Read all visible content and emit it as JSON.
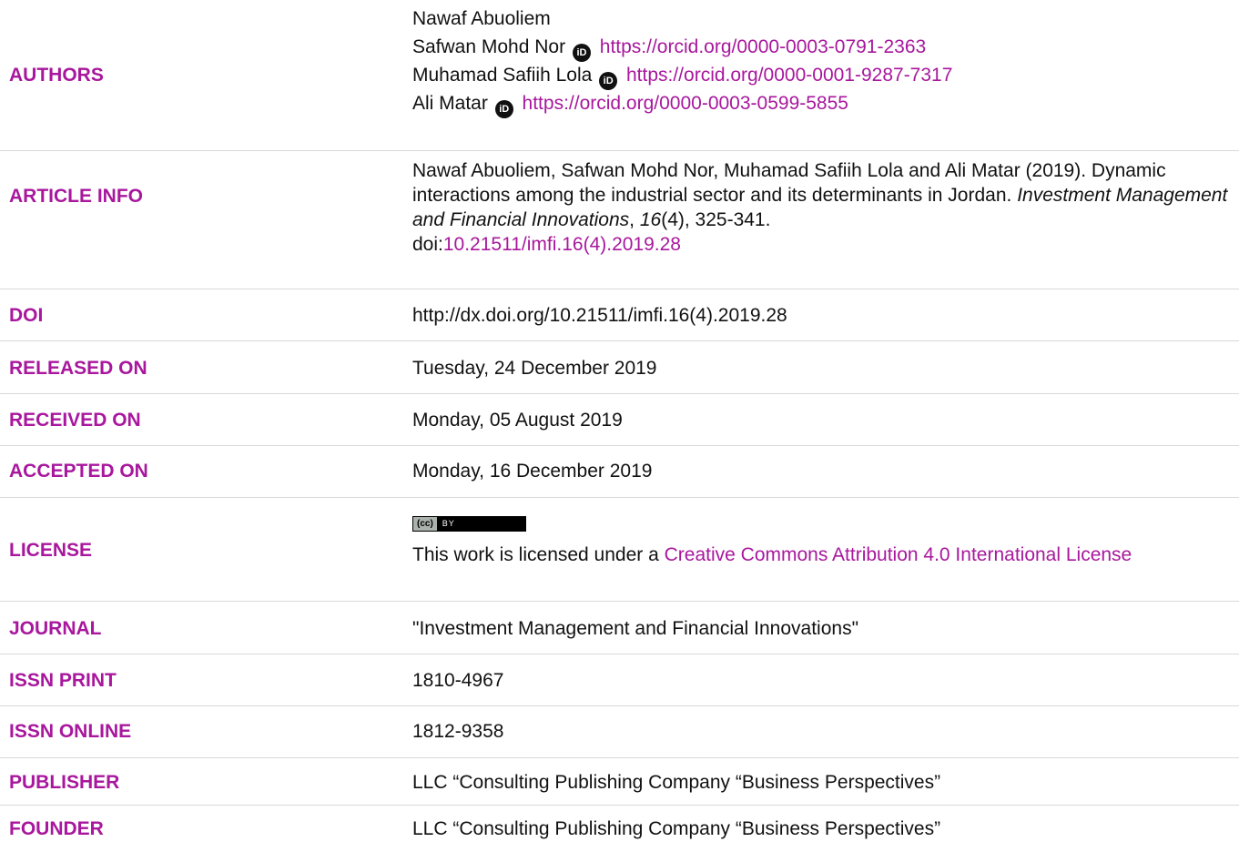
{
  "authors": {
    "label": "AUTHORS",
    "list": [
      {
        "name": "Nawaf Abuoliem",
        "orcid": ""
      },
      {
        "name": "Safwan Mohd Nor",
        "orcid": "https://orcid.org/0000-0003-0791-2363"
      },
      {
        "name": "Muhamad Safiih Lola",
        "orcid": "https://orcid.org/0000-0001-9287-7317"
      },
      {
        "name": "Ali Matar",
        "orcid": "https://orcid.org/0000-0003-0599-5855"
      }
    ]
  },
  "article_info": {
    "label": "ARTICLE INFO",
    "citation_start": "Nawaf Abuoliem, Safwan Mohd Nor, Muhamad Safiih Lola and Ali Matar (2019). Dynamic interactions among the industrial sector and its determinants in Jordan. ",
    "journal_italic": "Investment Management and Financial Innovations",
    "comma": ", ",
    "volume_italic": "16",
    "issue_pages": "(4), 325-341.",
    "doi_prefix": "doi:",
    "doi_link": "10.21511/imfi.16(4).2019.28"
  },
  "doi": {
    "label": "DOI",
    "value": "http://dx.doi.org/10.21511/imfi.16(4).2019.28"
  },
  "released": {
    "label": "RELEASED ON",
    "value": "Tuesday, 24 December 2019"
  },
  "received": {
    "label": "RECEIVED ON",
    "value": "Monday, 05 August 2019"
  },
  "accepted": {
    "label": "ACCEPTED ON",
    "value": "Monday, 16 December 2019"
  },
  "license": {
    "label": "LICENSE",
    "badge_left": "(cc)",
    "badge_right": "BY",
    "text": "This work is licensed under a ",
    "link": "Creative Commons Attribution 4.0 International License"
  },
  "journal": {
    "label": "JOURNAL",
    "value": "\"Investment Management and Financial Innovations\""
  },
  "issn_print": {
    "label": "ISSN PRINT",
    "value": "1810-4967"
  },
  "issn_online": {
    "label": "ISSN ONLINE",
    "value": "1812-9358"
  },
  "publisher": {
    "label": "PUBLISHER",
    "value": "LLC “Consulting Publishing Company “Business Perspectives”"
  },
  "founder": {
    "label": "FOUNDER",
    "value": "LLC “Consulting Publishing Company “Business Perspectives”"
  },
  "icons": {
    "orcid_glyph": "iD"
  },
  "colors": {
    "accent": "#a8179d",
    "text": "#111111",
    "divider": "#d9d9d9"
  }
}
